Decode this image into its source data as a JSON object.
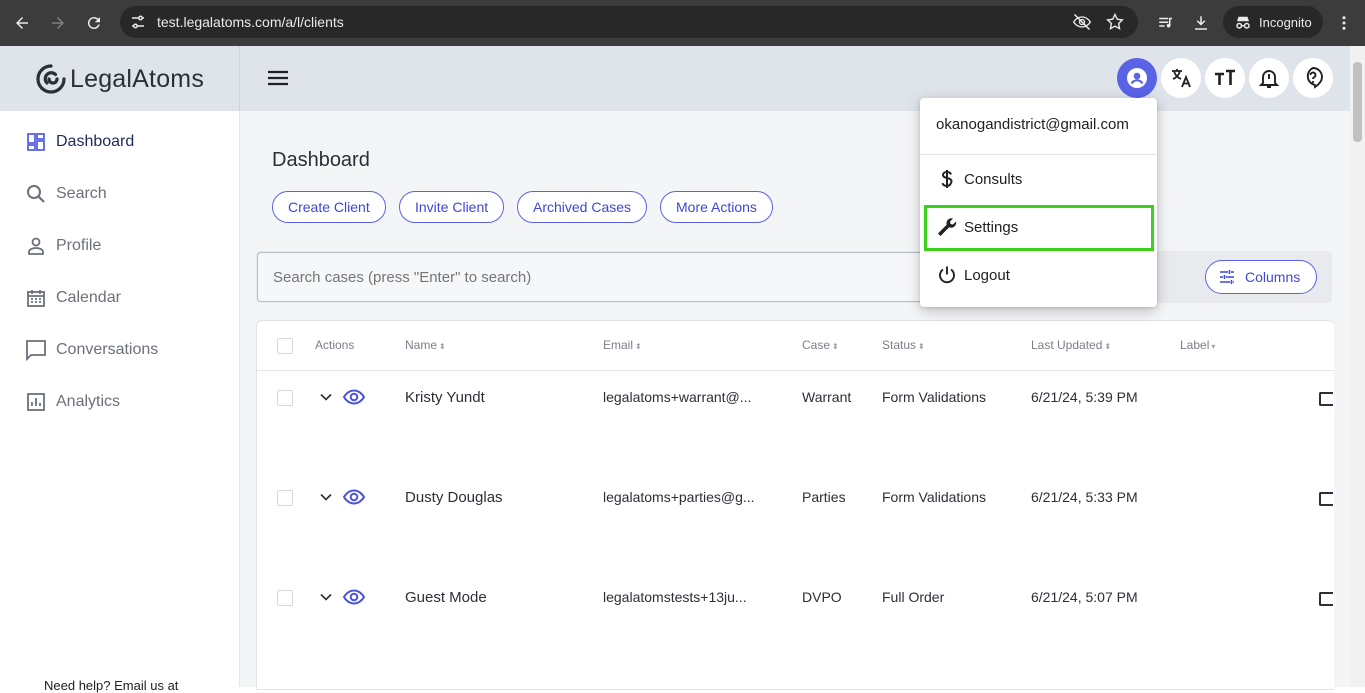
{
  "browser": {
    "url": "test.legalatoms.com/a/l/clients",
    "incognito_label": "Incognito"
  },
  "app": {
    "logo_text_1": "Legal",
    "logo_text_2": "Atoms"
  },
  "sidebar": {
    "items": [
      {
        "label": "Dashboard",
        "icon": "dashboard-icon",
        "active": true
      },
      {
        "label": "Search",
        "icon": "search-icon",
        "active": false
      },
      {
        "label": "Profile",
        "icon": "person-icon",
        "active": false
      },
      {
        "label": "Calendar",
        "icon": "calendar-icon",
        "active": false
      },
      {
        "label": "Conversations",
        "icon": "chat-icon",
        "active": false
      },
      {
        "label": "Analytics",
        "icon": "analytics-icon",
        "active": false
      }
    ],
    "help_text": "Need help? Email us at"
  },
  "main": {
    "title": "Dashboard",
    "actions": [
      "Create Client",
      "Invite Client",
      "Archived Cases",
      "More Actions"
    ],
    "search_placeholder": "Search cases (press \"Enter\" to search)",
    "columns_label": "Columns"
  },
  "table": {
    "headers": [
      "Actions",
      "Name",
      "Email",
      "Case",
      "Status",
      "Last Updated",
      "Label"
    ],
    "rows": [
      {
        "name": "Kristy Yundt",
        "email": "legalatoms+warrant@...",
        "case": "Warrant",
        "status": "Form Validations",
        "updated": "6/21/24, 5:39 PM"
      },
      {
        "name": "Dusty Douglas",
        "email": "legalatoms+parties@g...",
        "case": "Parties",
        "status": "Form Validations",
        "updated": "6/21/24, 5:33 PM"
      },
      {
        "name": "Guest Mode",
        "email": "legalatomstests+13ju...",
        "case": "DVPO",
        "status": "Full Order",
        "updated": "6/21/24, 5:07 PM"
      }
    ]
  },
  "user_menu": {
    "email": "okanogandistrict@gmail.com",
    "items": [
      {
        "label": "Consults",
        "icon": "dollar-icon"
      },
      {
        "label": "Settings",
        "icon": "wrench-icon"
      },
      {
        "label": "Logout",
        "icon": "power-icon"
      }
    ],
    "highlight_color": "#3bd11a"
  },
  "colors": {
    "accent": "#5a62e6",
    "header_bg": "#dfe3ea"
  }
}
